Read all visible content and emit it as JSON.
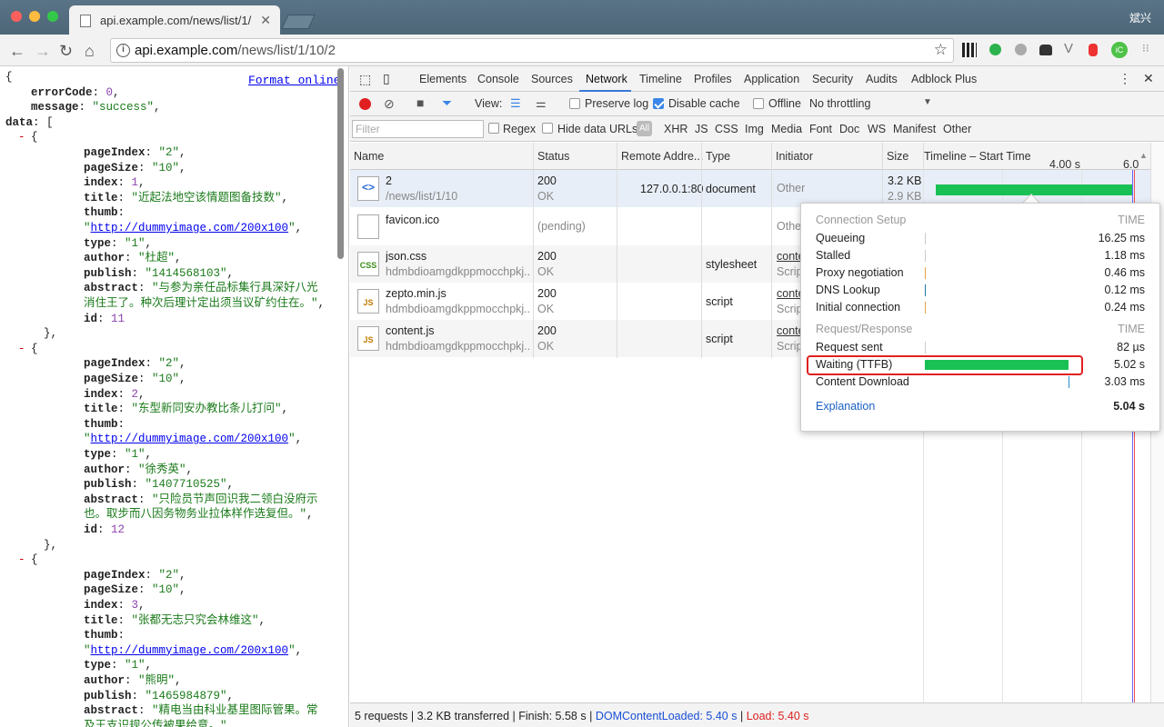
{
  "browser": {
    "tab_title": "api.example.com/news/list/1/",
    "user": "斌兴",
    "url_host": "api.example.com",
    "url_path": "/news/list/1/10/2"
  },
  "json_view": {
    "format_link": "Format online",
    "lines": [
      {
        "indent": 0,
        "parts": [
          {
            "t": "punc",
            "v": "{"
          }
        ]
      },
      {
        "indent": 1,
        "parts": [
          {
            "t": "key",
            "v": "errorCode"
          },
          {
            "t": "punc",
            "v": ": "
          },
          {
            "t": "num",
            "v": "0"
          },
          {
            "t": "punc",
            "v": ","
          }
        ]
      },
      {
        "indent": 1,
        "parts": [
          {
            "t": "key",
            "v": "message"
          },
          {
            "t": "punc",
            "v": ": "
          },
          {
            "t": "str",
            "v": "\"success\""
          },
          {
            "t": "punc",
            "v": ","
          }
        ]
      },
      {
        "indent": 0,
        "toggle": true,
        "parts": [
          {
            "t": "key",
            "v": "data"
          },
          {
            "t": "punc",
            "v": ": ["
          }
        ]
      },
      {
        "indent": 1,
        "toggle": true,
        "parts": [
          {
            "t": "punc",
            "v": "{"
          }
        ]
      },
      {
        "indent": 3,
        "parts": [
          {
            "t": "key",
            "v": "pageIndex"
          },
          {
            "t": "punc",
            "v": ": "
          },
          {
            "t": "str",
            "v": "\"2\""
          },
          {
            "t": "punc",
            "v": ","
          }
        ]
      },
      {
        "indent": 3,
        "parts": [
          {
            "t": "key",
            "v": "pageSize"
          },
          {
            "t": "punc",
            "v": ": "
          },
          {
            "t": "str",
            "v": "\"10\""
          },
          {
            "t": "punc",
            "v": ","
          }
        ]
      },
      {
        "indent": 3,
        "parts": [
          {
            "t": "key",
            "v": "index"
          },
          {
            "t": "punc",
            "v": ": "
          },
          {
            "t": "num",
            "v": "1"
          },
          {
            "t": "punc",
            "v": ","
          }
        ]
      },
      {
        "indent": 3,
        "parts": [
          {
            "t": "key",
            "v": "title"
          },
          {
            "t": "punc",
            "v": ": "
          },
          {
            "t": "str",
            "v": "\"近起法地空该情题图备技数\""
          },
          {
            "t": "punc",
            "v": ","
          }
        ]
      },
      {
        "indent": 3,
        "parts": [
          {
            "t": "key",
            "v": "thumb"
          },
          {
            "t": "punc",
            "v": ":"
          }
        ]
      },
      {
        "indent": 3,
        "parts": [
          {
            "t": "str",
            "v": "\""
          },
          {
            "t": "lnk",
            "v": "http://dummyimage.com/200x100"
          },
          {
            "t": "str",
            "v": "\""
          },
          {
            "t": "punc",
            "v": ","
          }
        ]
      },
      {
        "indent": 3,
        "parts": [
          {
            "t": "key",
            "v": "type"
          },
          {
            "t": "punc",
            "v": ": "
          },
          {
            "t": "str",
            "v": "\"1\""
          },
          {
            "t": "punc",
            "v": ","
          }
        ]
      },
      {
        "indent": 3,
        "parts": [
          {
            "t": "key",
            "v": "author"
          },
          {
            "t": "punc",
            "v": ": "
          },
          {
            "t": "str",
            "v": "\"杜超\""
          },
          {
            "t": "punc",
            "v": ","
          }
        ]
      },
      {
        "indent": 3,
        "parts": [
          {
            "t": "key",
            "v": "publish"
          },
          {
            "t": "punc",
            "v": ": "
          },
          {
            "t": "str",
            "v": "\"1414568103\""
          },
          {
            "t": "punc",
            "v": ","
          }
        ]
      },
      {
        "indent": 3,
        "parts": [
          {
            "t": "key",
            "v": "abstract"
          },
          {
            "t": "punc",
            "v": ": "
          },
          {
            "t": "str",
            "v": "\"与参为亲任品标集行具深好八光"
          }
        ]
      },
      {
        "indent": 3,
        "parts": [
          {
            "t": "str",
            "v": "消住王了。种次后理计定出须当议矿约住在。\""
          },
          {
            "t": "punc",
            "v": ","
          }
        ]
      },
      {
        "indent": 3,
        "parts": [
          {
            "t": "key",
            "v": "id"
          },
          {
            "t": "punc",
            "v": ": "
          },
          {
            "t": "num",
            "v": "11"
          }
        ]
      },
      {
        "indent": 2,
        "parts": [
          {
            "t": "punc",
            "v": "},"
          }
        ]
      },
      {
        "indent": 1,
        "toggle": true,
        "parts": [
          {
            "t": "punc",
            "v": "{"
          }
        ]
      },
      {
        "indent": 3,
        "parts": [
          {
            "t": "key",
            "v": "pageIndex"
          },
          {
            "t": "punc",
            "v": ": "
          },
          {
            "t": "str",
            "v": "\"2\""
          },
          {
            "t": "punc",
            "v": ","
          }
        ]
      },
      {
        "indent": 3,
        "parts": [
          {
            "t": "key",
            "v": "pageSize"
          },
          {
            "t": "punc",
            "v": ": "
          },
          {
            "t": "str",
            "v": "\"10\""
          },
          {
            "t": "punc",
            "v": ","
          }
        ]
      },
      {
        "indent": 3,
        "parts": [
          {
            "t": "key",
            "v": "index"
          },
          {
            "t": "punc",
            "v": ": "
          },
          {
            "t": "num",
            "v": "2"
          },
          {
            "t": "punc",
            "v": ","
          }
        ]
      },
      {
        "indent": 3,
        "parts": [
          {
            "t": "key",
            "v": "title"
          },
          {
            "t": "punc",
            "v": ": "
          },
          {
            "t": "str",
            "v": "\"东型新同安办教比条儿打问\""
          },
          {
            "t": "punc",
            "v": ","
          }
        ]
      },
      {
        "indent": 3,
        "parts": [
          {
            "t": "key",
            "v": "thumb"
          },
          {
            "t": "punc",
            "v": ":"
          }
        ]
      },
      {
        "indent": 3,
        "parts": [
          {
            "t": "str",
            "v": "\""
          },
          {
            "t": "lnk",
            "v": "http://dummyimage.com/200x100"
          },
          {
            "t": "str",
            "v": "\""
          },
          {
            "t": "punc",
            "v": ","
          }
        ]
      },
      {
        "indent": 3,
        "parts": [
          {
            "t": "key",
            "v": "type"
          },
          {
            "t": "punc",
            "v": ": "
          },
          {
            "t": "str",
            "v": "\"1\""
          },
          {
            "t": "punc",
            "v": ","
          }
        ]
      },
      {
        "indent": 3,
        "parts": [
          {
            "t": "key",
            "v": "author"
          },
          {
            "t": "punc",
            "v": ": "
          },
          {
            "t": "str",
            "v": "\"徐秀英\""
          },
          {
            "t": "punc",
            "v": ","
          }
        ]
      },
      {
        "indent": 3,
        "parts": [
          {
            "t": "key",
            "v": "publish"
          },
          {
            "t": "punc",
            "v": ": "
          },
          {
            "t": "str",
            "v": "\"1407710525\""
          },
          {
            "t": "punc",
            "v": ","
          }
        ]
      },
      {
        "indent": 3,
        "parts": [
          {
            "t": "key",
            "v": "abstract"
          },
          {
            "t": "punc",
            "v": ": "
          },
          {
            "t": "str",
            "v": "\"只险员节声回识我二领白没府示"
          }
        ]
      },
      {
        "indent": 3,
        "parts": [
          {
            "t": "str",
            "v": "也。取步而八因务物务业拉体样作选复但。\""
          },
          {
            "t": "punc",
            "v": ","
          }
        ]
      },
      {
        "indent": 3,
        "parts": [
          {
            "t": "key",
            "v": "id"
          },
          {
            "t": "punc",
            "v": ": "
          },
          {
            "t": "num",
            "v": "12"
          }
        ]
      },
      {
        "indent": 2,
        "parts": [
          {
            "t": "punc",
            "v": "},"
          }
        ]
      },
      {
        "indent": 1,
        "toggle": true,
        "parts": [
          {
            "t": "punc",
            "v": "{"
          }
        ]
      },
      {
        "indent": 3,
        "parts": [
          {
            "t": "key",
            "v": "pageIndex"
          },
          {
            "t": "punc",
            "v": ": "
          },
          {
            "t": "str",
            "v": "\"2\""
          },
          {
            "t": "punc",
            "v": ","
          }
        ]
      },
      {
        "indent": 3,
        "parts": [
          {
            "t": "key",
            "v": "pageSize"
          },
          {
            "t": "punc",
            "v": ": "
          },
          {
            "t": "str",
            "v": "\"10\""
          },
          {
            "t": "punc",
            "v": ","
          }
        ]
      },
      {
        "indent": 3,
        "parts": [
          {
            "t": "key",
            "v": "index"
          },
          {
            "t": "punc",
            "v": ": "
          },
          {
            "t": "num",
            "v": "3"
          },
          {
            "t": "punc",
            "v": ","
          }
        ]
      },
      {
        "indent": 3,
        "parts": [
          {
            "t": "key",
            "v": "title"
          },
          {
            "t": "punc",
            "v": ": "
          },
          {
            "t": "str",
            "v": "\"张都无志只究会林维这\""
          },
          {
            "t": "punc",
            "v": ","
          }
        ]
      },
      {
        "indent": 3,
        "parts": [
          {
            "t": "key",
            "v": "thumb"
          },
          {
            "t": "punc",
            "v": ":"
          }
        ]
      },
      {
        "indent": 3,
        "parts": [
          {
            "t": "str",
            "v": "\""
          },
          {
            "t": "lnk",
            "v": "http://dummyimage.com/200x100"
          },
          {
            "t": "str",
            "v": "\""
          },
          {
            "t": "punc",
            "v": ","
          }
        ]
      },
      {
        "indent": 3,
        "parts": [
          {
            "t": "key",
            "v": "type"
          },
          {
            "t": "punc",
            "v": ": "
          },
          {
            "t": "str",
            "v": "\"1\""
          },
          {
            "t": "punc",
            "v": ","
          }
        ]
      },
      {
        "indent": 3,
        "parts": [
          {
            "t": "key",
            "v": "author"
          },
          {
            "t": "punc",
            "v": ": "
          },
          {
            "t": "str",
            "v": "\"熊明\""
          },
          {
            "t": "punc",
            "v": ","
          }
        ]
      },
      {
        "indent": 3,
        "parts": [
          {
            "t": "key",
            "v": "publish"
          },
          {
            "t": "punc",
            "v": ": "
          },
          {
            "t": "str",
            "v": "\"1465984879\""
          },
          {
            "t": "punc",
            "v": ","
          }
        ]
      },
      {
        "indent": 3,
        "parts": [
          {
            "t": "key",
            "v": "abstract"
          },
          {
            "t": "punc",
            "v": ": "
          },
          {
            "t": "str",
            "v": "\"精电当由科业基里图际管果。常"
          }
        ]
      },
      {
        "indent": 3,
        "parts": [
          {
            "t": "str",
            "v": "及王支识规公传被果给意。\""
          },
          {
            "t": "punc",
            "v": ","
          }
        ]
      }
    ]
  },
  "devtools": {
    "tabs": [
      "Elements",
      "Console",
      "Sources",
      "Network",
      "Timeline",
      "Profiles",
      "Application",
      "Security",
      "Audits",
      "Adblock Plus"
    ],
    "active_tab": "Network",
    "view_label": "View:",
    "preserve_log": "Preserve log",
    "disable_cache": "Disable cache",
    "offline": "Offline",
    "throttling": "No throttling",
    "filter_placeholder": "Filter",
    "regex": "Regex",
    "hide_data_urls": "Hide data URLs",
    "all_label": "All",
    "types": [
      "XHR",
      "JS",
      "CSS",
      "Img",
      "Media",
      "Font",
      "Doc",
      "WS",
      "Manifest",
      "Other"
    ],
    "columns": {
      "name": "Name",
      "status": "Status",
      "remote": "Remote Addre...",
      "type": "Type",
      "initiator": "Initiator",
      "size": "Size",
      "timeline": "Timeline – Start Time"
    },
    "timeline_ticks": [
      "4.00 s",
      "6.0"
    ],
    "requests": [
      {
        "icon": "<>",
        "name": "2",
        "path": "/news/list/1/10",
        "status": "200",
        "status_text": "OK",
        "remote": "127.0.0.1:80",
        "type": "document",
        "initiator": "Other",
        "initiator_sub": "",
        "size": "3.2 KB",
        "size_sub": "2.9 KB"
      },
      {
        "icon": "",
        "name": "favicon.ico",
        "path": "",
        "status": "(pending)",
        "status_text": "",
        "remote": "",
        "type": "",
        "initiator": "Othe",
        "initiator_sub": "",
        "size": "",
        "size_sub": ""
      },
      {
        "icon": "CSS",
        "name": "json.css",
        "path": "hdmbdioamgdkppmocchpkj...",
        "status": "200",
        "status_text": "OK",
        "remote": "",
        "type": "stylesheet",
        "initiator": "conte",
        "initiator_sub": "Scrip",
        "size": "",
        "size_sub": ""
      },
      {
        "icon": "JS",
        "name": "zepto.min.js",
        "path": "hdmbdioamgdkppmocchpkj...",
        "status": "200",
        "status_text": "OK",
        "remote": "",
        "type": "script",
        "initiator": "conte",
        "initiator_sub": "Scrip",
        "size": "",
        "size_sub": ""
      },
      {
        "icon": "JS",
        "name": "content.js",
        "path": "hdmbdioamgdkppmocchpkj...",
        "status": "200",
        "status_text": "OK",
        "remote": "",
        "type": "script",
        "initiator": "conte",
        "initiator_sub": "Scrip",
        "size": "",
        "size_sub": ""
      }
    ],
    "timing": {
      "setup_header": "Connection Setup",
      "time_header": "TIME",
      "setup_rows": [
        {
          "label": "Queueing",
          "time": "16.25 ms",
          "color": "#cccccc"
        },
        {
          "label": "Stalled",
          "time": "1.18 ms",
          "color": "#cccccc"
        },
        {
          "label": "Proxy negotiation",
          "time": "0.46 ms",
          "color": "#e8a04a"
        },
        {
          "label": "DNS Lookup",
          "time": "0.12 ms",
          "color": "#1f7a9c"
        },
        {
          "label": "Initial connection",
          "time": "0.24 ms",
          "color": "#e8a04a"
        }
      ],
      "rr_header": "Request/Response",
      "rr_rows": [
        {
          "label": "Request sent",
          "time": "82 µs",
          "color": "#cccccc"
        },
        {
          "label": "Waiting (TTFB)",
          "time": "5.02 s",
          "color": "#19c155"
        },
        {
          "label": "Content Download",
          "time": "3.03 ms",
          "color": "#2a8ad1"
        }
      ],
      "explanation": "Explanation",
      "total": "5.04 s"
    },
    "status": {
      "requests": "5 requests",
      "transferred": "3.2 KB transferred",
      "finish": "Finish: 5.58 s",
      "dcl": "DOMContentLoaded: 5.40 s",
      "load": "Load: 5.40 s"
    }
  }
}
